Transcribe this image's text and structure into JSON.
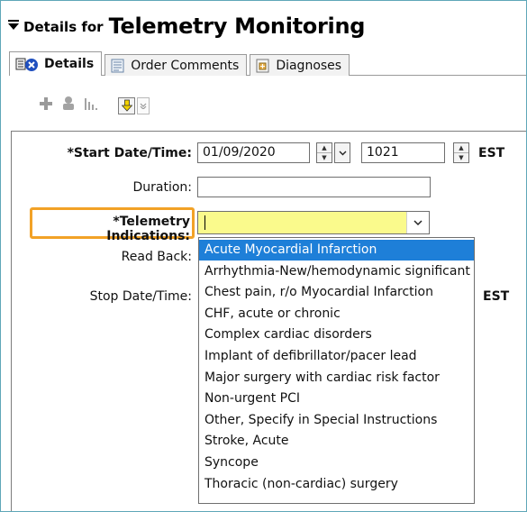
{
  "header": {
    "collapse_icon": "triangle-down-icon",
    "prefix": "Details for",
    "title": "Telemetry Monitoring"
  },
  "tabs": [
    {
      "label": "Details",
      "icon": "details-form-icon",
      "active": true
    },
    {
      "label": "Order Comments",
      "icon": "comments-icon",
      "active": false
    },
    {
      "label": "Diagnoses",
      "icon": "diagnoses-icon",
      "active": false
    }
  ],
  "toolbar": {
    "icons": [
      "add-icon",
      "remove-icon",
      "chart-icon",
      "yellow-down-arrow-icon",
      "chevron-down-icon"
    ]
  },
  "form": {
    "start_label": "*Start Date/Time:",
    "start_date": "01/09/2020",
    "start_time": "1021",
    "start_tz": "EST",
    "duration_label": "Duration:",
    "duration_value": "",
    "indications_label": "*Telemetry Indications:",
    "indications_value": "",
    "readback_label": "Read Back:",
    "stop_label": "Stop Date/Time:",
    "stop_tz": "EST"
  },
  "dropdown": {
    "selected_index": 0,
    "options": [
      "Acute Myocardial Infarction",
      "Arrhythmia-New/hemodynamic significant",
      "Chest pain, r/o Myocardial Infarction",
      "CHF, acute or chronic",
      "Complex cardiac disorders",
      "Implant of defibrillator/pacer lead",
      "Major surgery with cardiac risk factor",
      "Non-urgent PCI",
      "Other, Specify in Special Instructions",
      "Stroke, Acute",
      "Syncope",
      "Thoracic (non-cardiac) surgery"
    ]
  },
  "colors": {
    "highlight": "#f2a227",
    "required_field": "#fafa8c",
    "selection": "#1e7fd8",
    "frame_border": "#5fa7b8"
  }
}
